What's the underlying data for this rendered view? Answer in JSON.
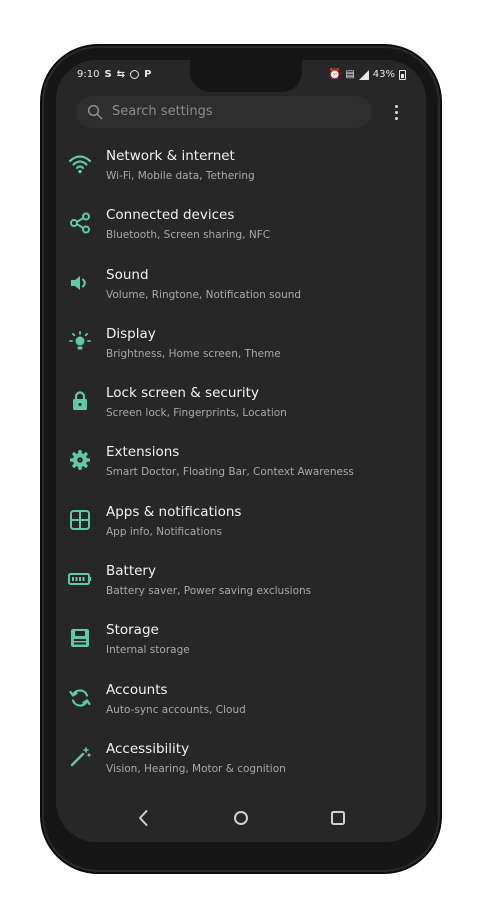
{
  "status_bar": {
    "time": "9:10",
    "left_icons": [
      "S",
      "P"
    ],
    "battery": "43%"
  },
  "search": {
    "placeholder": "Search settings"
  },
  "accent_color": "#5fc9a8",
  "settings": [
    {
      "title": "Network & internet",
      "subtitle": "Wi-Fi, Mobile data, Tethering",
      "icon": "wifi-icon"
    },
    {
      "title": "Connected devices",
      "subtitle": "Bluetooth, Screen sharing, NFC",
      "icon": "share-icon"
    },
    {
      "title": "Sound",
      "subtitle": "Volume, Ringtone, Notification sound",
      "icon": "volume-icon"
    },
    {
      "title": "Display",
      "subtitle": "Brightness, Home screen, Theme",
      "icon": "brightness-icon"
    },
    {
      "title": "Lock screen & security",
      "subtitle": "Screen lock, Fingerprints, Location",
      "icon": "lock-icon"
    },
    {
      "title": "Extensions",
      "subtitle": "Smart Doctor, Floating Bar, Context Awareness",
      "icon": "gear-icon"
    },
    {
      "title": "Apps & notifications",
      "subtitle": "App info, Notifications",
      "icon": "apps-grid-icon"
    },
    {
      "title": "Battery",
      "subtitle": "Battery saver, Power saving exclusions",
      "icon": "battery-icon"
    },
    {
      "title": "Storage",
      "subtitle": "Internal storage",
      "icon": "storage-icon"
    },
    {
      "title": "Accounts",
      "subtitle": "Auto-sync accounts, Cloud",
      "icon": "sync-icon"
    },
    {
      "title": "Accessibility",
      "subtitle": "Vision, Hearing, Motor & cognition",
      "icon": "magic-wand-icon"
    }
  ]
}
